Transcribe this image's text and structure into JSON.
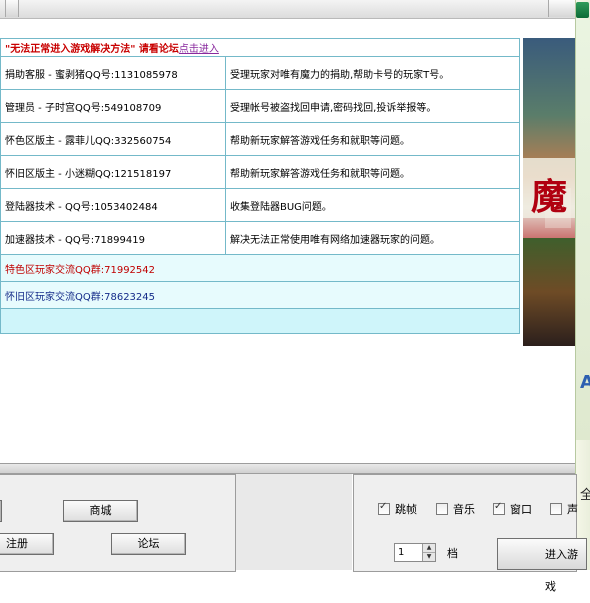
{
  "header": {
    "notice_text": "\"无法正常进入游戏解决方法\" 请看论坛",
    "notice_link": "点击进入"
  },
  "contacts": [
    {
      "role": "捐助客服 - 蜜剥猪QQ号:1131085978",
      "desc": "受理玩家对唯有魔力的捐助,帮助卡号的玩家T号。"
    },
    {
      "role": "管理员 - 子时宫QQ号:549108709",
      "desc": "受理帐号被盗找回申请,密码找回,投诉举报等。"
    },
    {
      "role": "怀色区版主 - 露菲儿QQ:332560754",
      "desc": "帮助新玩家解答游戏任务和就职等问题。"
    },
    {
      "role": "怀旧区版主 - 小迷糊QQ:121518197",
      "desc": "帮助新玩家解答游戏任务和就职等问题。"
    },
    {
      "role": "登陆器技术 - QQ号:1053402484",
      "desc": "收集登陆器BUG问题。"
    },
    {
      "role": "加速器技术 - QQ号:71899419",
      "desc": "解决无法正常使用唯有网络加速器玩家的问题。"
    }
  ],
  "groups": {
    "red": "特色区玩家交流QQ群:71992542",
    "navy": "怀旧区玩家交流QQ群:78623245"
  },
  "poster": {
    "title": "魔"
  },
  "buttons": {
    "shop": "商城",
    "register": "注册",
    "forum": "论坛",
    "enter": "进入游戏"
  },
  "options": [
    {
      "label": "跳帧",
      "checked": true
    },
    {
      "label": "音乐",
      "checked": false
    },
    {
      "label": "窗口",
      "checked": true
    },
    {
      "label": "声",
      "checked": false
    }
  ],
  "spinner": {
    "value": "1",
    "unit": "档"
  },
  "right_strip": {
    "letter": "A",
    "char": "全"
  }
}
